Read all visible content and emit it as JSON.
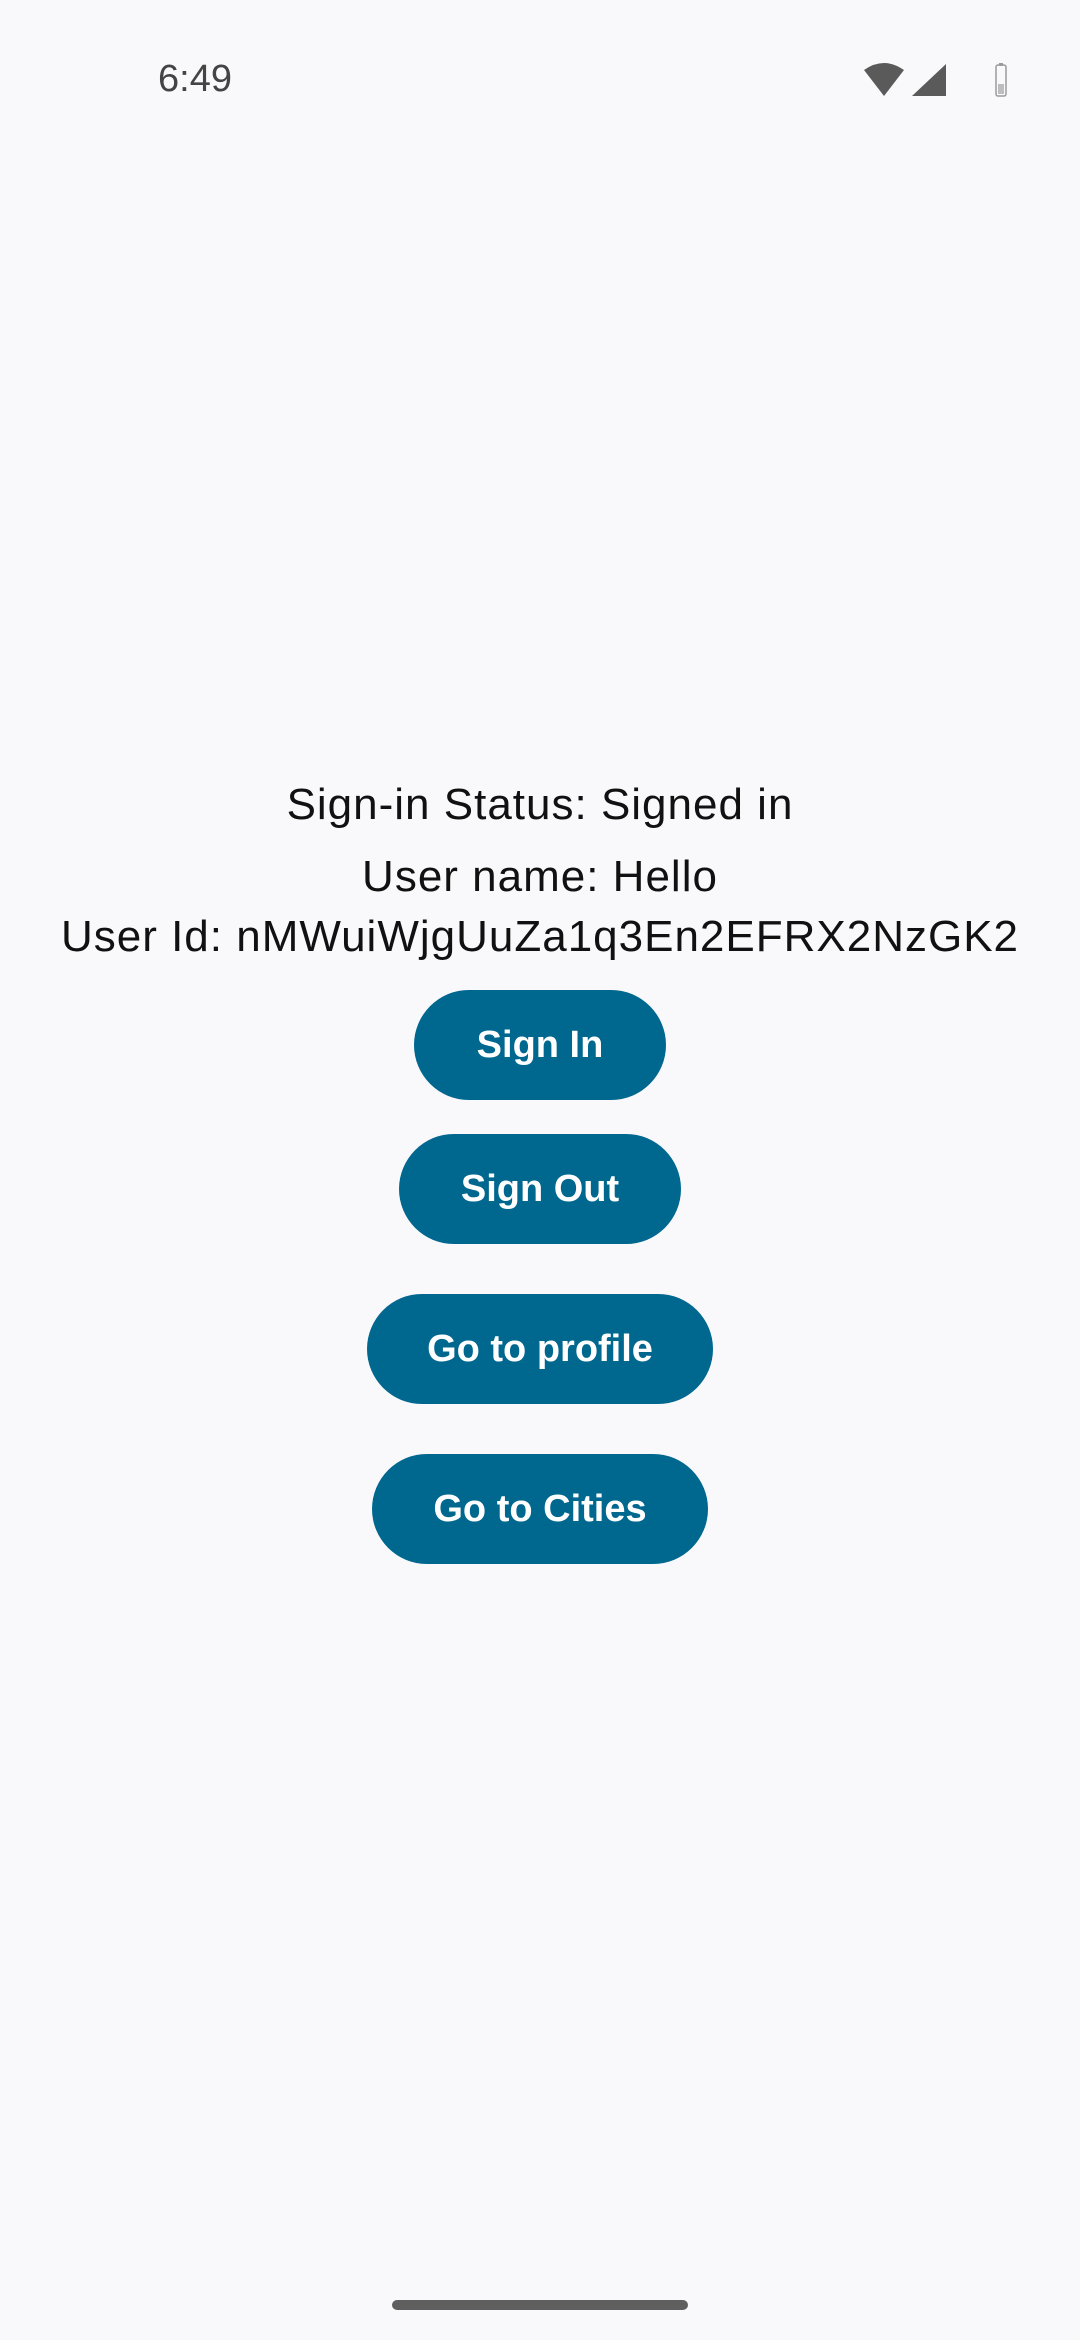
{
  "status_bar": {
    "time": "6:49",
    "icons": [
      "wifi-icon",
      "cellular-signal-icon",
      "battery-icon"
    ]
  },
  "main": {
    "sign_in_status": "Sign-in Status: Signed in",
    "user_name": "User name: Hello",
    "user_id": "User Id: nMWuiWjgUuZa1q3En2EFRX2NzGK2",
    "buttons": {
      "sign_in": "Sign In",
      "sign_out": "Sign Out",
      "go_to_profile": "Go to profile",
      "go_to_cities": "Go to Cities"
    }
  },
  "colors": {
    "background": "#f9f9fb",
    "button": "#00678f",
    "button_text": "#ffffff",
    "text": "#111111"
  }
}
